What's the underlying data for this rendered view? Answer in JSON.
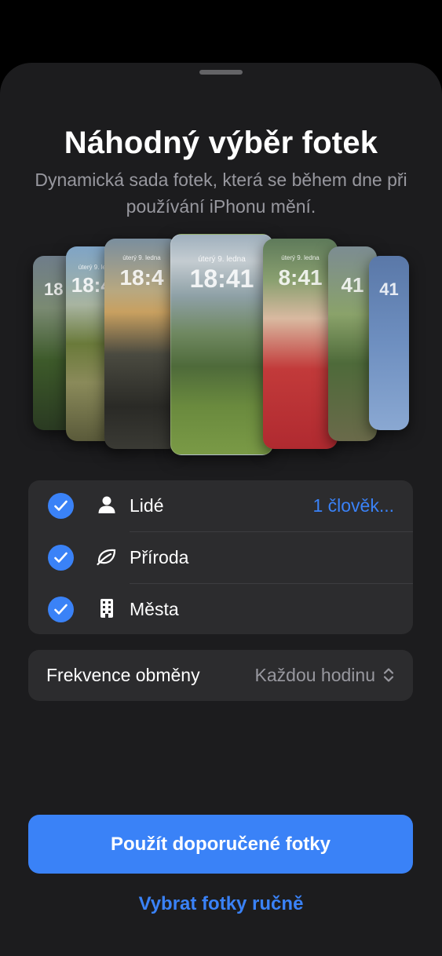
{
  "title": "Náhodný výběr fotek",
  "subtitle": "Dynamická sada fotek, která se během dne při používání iPhonu mění.",
  "previews": {
    "date": "úterý 9. ledna",
    "time": "18:41",
    "time_partial": "18:4",
    "time_short": "18",
    "time_right": "8:41",
    "time_far_right": "41"
  },
  "categories": [
    {
      "label": "Lidé",
      "value": "1 člověk...",
      "icon": "person-icon",
      "checked": true
    },
    {
      "label": "Příroda",
      "icon": "leaf-icon",
      "checked": true
    },
    {
      "label": "Města",
      "icon": "building-icon",
      "checked": true
    }
  ],
  "frequency": {
    "label": "Frekvence obměny",
    "value": "Každou hodinu",
    "icon": "chevron-up-down-icon"
  },
  "actions": {
    "primary": "Použít doporučené fotky",
    "secondary": "Vybrat fotky ručně"
  },
  "colors": {
    "accent": "#3a82f7",
    "sheet": "#1c1c1e",
    "group": "#2c2c2e"
  }
}
